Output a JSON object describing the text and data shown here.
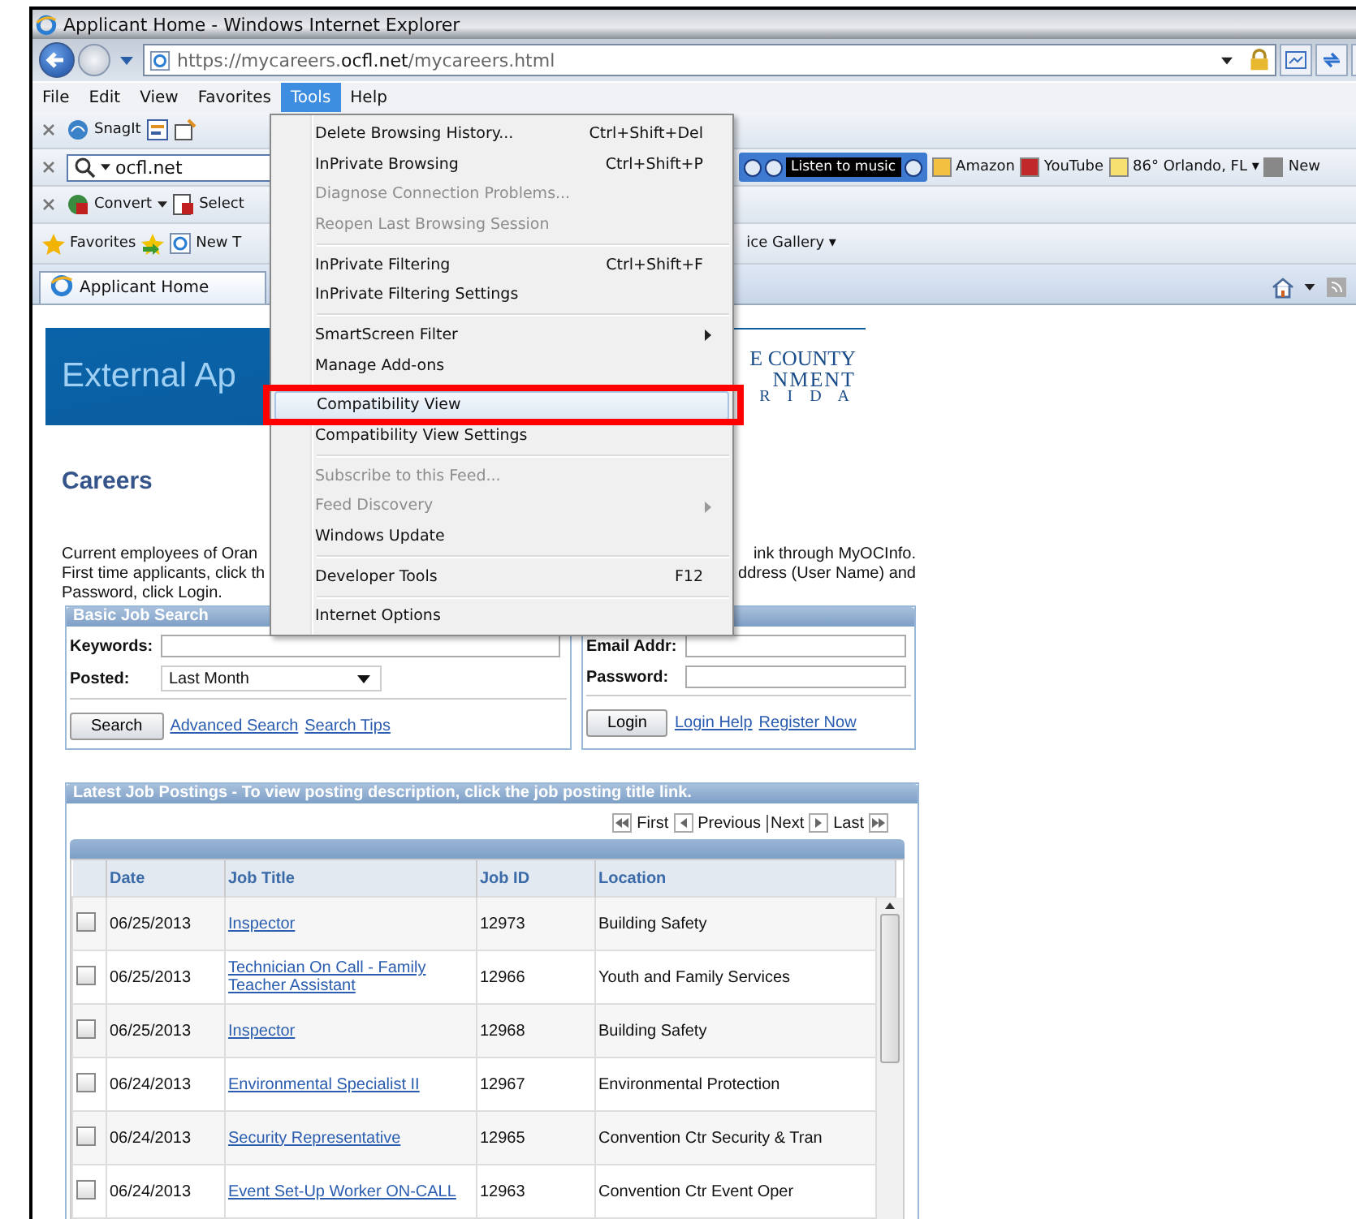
{
  "window": {
    "title": "Applicant Home - Windows Internet Explorer"
  },
  "address": {
    "prefix": "https://mycareers.",
    "domain": "ocfl.net",
    "path": "/mycareers.html"
  },
  "menubar": [
    {
      "label": "File",
      "selected": false
    },
    {
      "label": "Edit",
      "selected": false
    },
    {
      "label": "View",
      "selected": false
    },
    {
      "label": "Favorites",
      "selected": false
    },
    {
      "label": "Tools",
      "selected": true
    },
    {
      "label": "Help",
      "selected": false
    }
  ],
  "snagit_bar": {
    "label": "SnagIt"
  },
  "search_bar": {
    "value": "ocfl.net",
    "music": "Listen to music",
    "links": [
      "Amazon",
      "YouTube",
      "86° Orlando, FL ▾",
      "New"
    ]
  },
  "convert_bar": {
    "convert": "Convert",
    "select": "Select"
  },
  "favorites_bar": {
    "favorites": "Favorites",
    "new_tab": "New T",
    "gallery": "ice Gallery ▾"
  },
  "tab": {
    "label": "Applicant Home"
  },
  "tools_menu": [
    {
      "kind": "item",
      "label": "Delete Browsing History...",
      "shortcut": "Ctrl+Shift+Del",
      "disabled": false,
      "submenu": false,
      "selected": false
    },
    {
      "kind": "item",
      "label": "InPrivate Browsing",
      "shortcut": "Ctrl+Shift+P",
      "disabled": false,
      "submenu": false,
      "selected": false
    },
    {
      "kind": "item",
      "label": "Diagnose Connection Problems...",
      "disabled": true,
      "submenu": false,
      "selected": false
    },
    {
      "kind": "item",
      "label": "Reopen Last Browsing Session",
      "disabled": true,
      "submenu": false,
      "selected": false
    },
    {
      "kind": "separator"
    },
    {
      "kind": "item",
      "label": "InPrivate Filtering",
      "shortcut": "Ctrl+Shift+F",
      "disabled": false,
      "submenu": false,
      "selected": false
    },
    {
      "kind": "item",
      "label": "InPrivate Filtering Settings",
      "disabled": false,
      "submenu": false,
      "selected": false
    },
    {
      "kind": "separator"
    },
    {
      "kind": "item",
      "label": "SmartScreen Filter",
      "disabled": false,
      "submenu": true,
      "selected": false
    },
    {
      "kind": "item",
      "label": "Manage Add-ons",
      "disabled": false,
      "submenu": false,
      "selected": false
    },
    {
      "kind": "separator"
    },
    {
      "kind": "item",
      "label": "Compatibility View",
      "disabled": false,
      "submenu": false,
      "selected": true
    },
    {
      "kind": "item",
      "label": "Compatibility View Settings",
      "disabled": false,
      "submenu": false,
      "selected": false
    },
    {
      "kind": "separator"
    },
    {
      "kind": "item",
      "label": "Subscribe to this Feed...",
      "disabled": true,
      "submenu": false,
      "selected": false
    },
    {
      "kind": "item",
      "label": "Feed Discovery",
      "disabled": true,
      "submenu": true,
      "selected": false
    },
    {
      "kind": "item",
      "label": "Windows Update",
      "disabled": false,
      "submenu": false,
      "selected": false
    },
    {
      "kind": "separator"
    },
    {
      "kind": "item",
      "label": "Developer Tools",
      "shortcut": "F12",
      "disabled": false,
      "submenu": false,
      "selected": false
    },
    {
      "kind": "separator"
    },
    {
      "kind": "item",
      "label": "Internet Options",
      "disabled": false,
      "submenu": false,
      "selected": false
    }
  ],
  "banner": {
    "title": "External Ap",
    "logo_lines": [
      "E COUNTY",
      "NMENT",
      "R I D A"
    ]
  },
  "heading": "Careers",
  "intro": [
    {
      "left": "Current employees of Oran",
      "right": "ink through MyOCInfo."
    },
    {
      "left": "First time applicants, click th",
      "right": "ddress (User Name) and"
    },
    {
      "left": "Password, click Login."
    }
  ],
  "job_search": {
    "title": "Basic Job Search",
    "keywords_label": "Keywords:",
    "posted_label": "Posted:",
    "posted_value": "Last Month",
    "search_button": "Search",
    "links": [
      "Advanced Search",
      "Search Tips"
    ]
  },
  "login": {
    "email_label": "Email Addr:",
    "password_label": "Password:",
    "login_button": "Login",
    "links": [
      "Login Help",
      "Register Now"
    ]
  },
  "postings": {
    "title": "Latest Job Postings - To view posting description, click the job posting title link.",
    "pager": [
      "First",
      "Previous",
      "Next",
      "Last"
    ],
    "columns": [
      "Date",
      "Job Title",
      "Job ID",
      "Location"
    ],
    "rows": [
      {
        "checked": false,
        "date": "06/25/2013",
        "title": "Inspector",
        "id": "12973",
        "location": "Building Safety"
      },
      {
        "checked": false,
        "date": "06/25/2013",
        "title": "Technician On Call - Family Teacher Assistant",
        "id": "12966",
        "location": "Youth and Family Services"
      },
      {
        "checked": false,
        "date": "06/25/2013",
        "title": "Inspector",
        "id": "12968",
        "location": "Building Safety"
      },
      {
        "checked": false,
        "date": "06/24/2013",
        "title": "Environmental Specialist II",
        "id": "12967",
        "location": "Environmental Protection"
      },
      {
        "checked": false,
        "date": "06/24/2013",
        "title": "Security Representative",
        "id": "12965",
        "location": "Convention Ctr Security & Tran"
      },
      {
        "checked": false,
        "date": "06/24/2013",
        "title": "Event Set-Up Worker ON-CALL",
        "id": "12963",
        "location": "Convention Ctr Event Oper"
      }
    ]
  }
}
